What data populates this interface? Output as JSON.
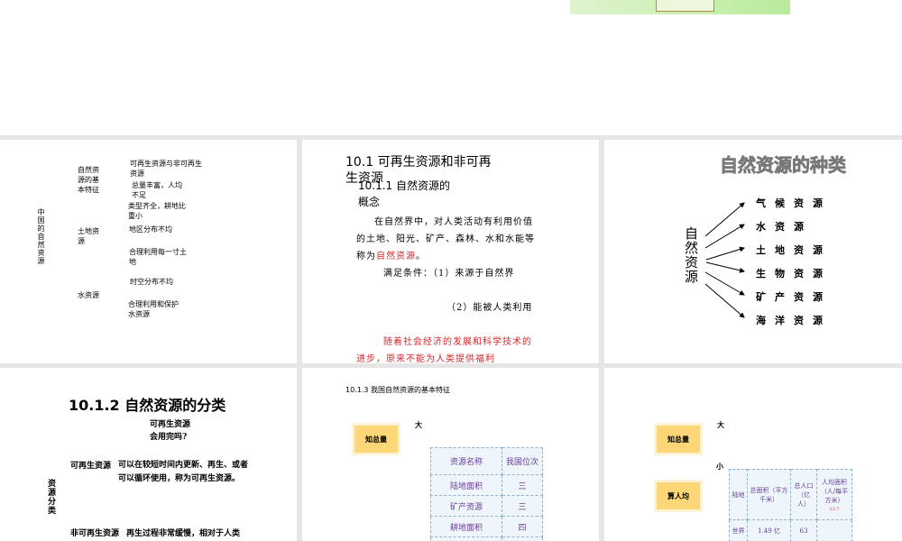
{
  "slide1": {
    "root": "中国的自然资源",
    "root_last": "源",
    "branches": [
      "自然资源的基本特征",
      "土地资源",
      "水资源"
    ],
    "leaves": [
      "可再生资源与非可再生资源",
      "总量丰富，人均不足",
      "类型齐全，耕地比重小",
      "地区分布不均",
      "合理利用每一寸土地",
      "时空分布不均",
      "合理利用和保护水资源"
    ]
  },
  "slide2": {
    "title": "10.1 可再生资源和非可再生资源",
    "subtitle": "10.1.1 自然资源的概念",
    "para1": "在自然界中，对人类活动有利用价值的土地、阳光、矿产、森林、水和水能等称为",
    "para1_red": "自然资源",
    "para1_end": "。",
    "cond1": "满足条件：（1）来源于自然界",
    "cond2": "（2）能被人类利用",
    "para2": "随着社会经济的发展和科学技术的进步，原来不能为人类提供福利"
  },
  "slide3": {
    "title": "自然资源的种类",
    "root": "自然资源",
    "items": [
      "气候资源",
      "水资源",
      "土地资源",
      "生物资源",
      "矿产资源",
      "海洋资源"
    ]
  },
  "slide4": {
    "title": "10.1.2 自然资源的分类",
    "question": "可再生资源会用完吗?",
    "side": "资源分类",
    "renew_label": "可再生资源",
    "renew_text": "可以在较短时间内更新、再生、或者可以循环使用，称为可再生资源。",
    "nonrenew_label": "非可再生资源",
    "nonrenew_text": "再生过程非常缓慢，相对于人类"
  },
  "slide5": {
    "title": "10.1.3 我国自然资源的基本特征",
    "tag": "知总量",
    "big": "大",
    "table": {
      "headers": [
        "资源名称",
        "我国位次"
      ],
      "rows": [
        [
          "陆地面积",
          "三"
        ],
        [
          "矿产资源",
          "三"
        ],
        [
          "耕地面积",
          "四"
        ]
      ]
    }
  },
  "slide6": {
    "tag1": "知总量",
    "tag2": "算人均",
    "big": "大",
    "small": "小",
    "table": {
      "headers": [
        "陆地",
        "总面积（平方千米）",
        "总人口（亿人）",
        "人均面积（人/每平方米）"
      ],
      "note": "23.7",
      "rows": [
        [
          "世界",
          "1.49 亿",
          "63",
          ""
        ]
      ]
    }
  }
}
